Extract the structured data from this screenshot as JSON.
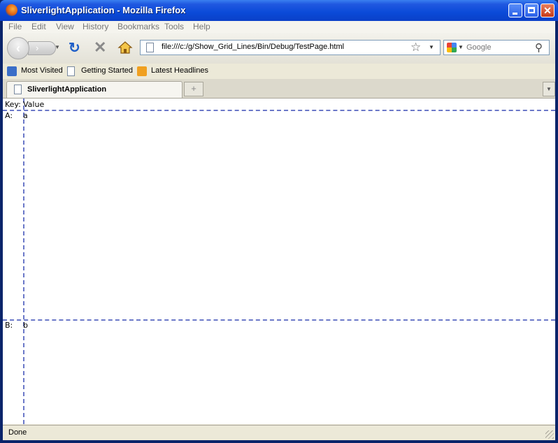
{
  "window": {
    "title": "SliverlightApplication - Mozilla Firefox",
    "close_glyph": "✕"
  },
  "menu": [
    "File",
    "Edit",
    "View",
    "History",
    "Bookmarks",
    "Tools",
    "Help"
  ],
  "nav": {
    "back_glyph": "‹",
    "forward_glyph": "›",
    "reload_glyph": "↻",
    "stop_glyph": "✕",
    "url": "file:///c:/g/Show_Grid_Lines/Bin/Debug/TestPage.html",
    "star_glyph": "☆",
    "search_placeholder": "Google",
    "search_glyph": "⚲"
  },
  "bookmarks": [
    "Most Visited",
    "Getting Started",
    "Latest Headlines"
  ],
  "tabs": [
    {
      "label": "SliverlightApplication"
    }
  ],
  "new_tab_glyph": "+",
  "page": {
    "header_key": "Key:",
    "header_value": "Value",
    "rows": [
      {
        "key": "A:",
        "value": "a"
      },
      {
        "key": "B:",
        "value": "b"
      }
    ]
  },
  "status": {
    "text": "Done"
  },
  "colors": {
    "titlebar": "#0a4ad8",
    "gridline": "#6b78c8",
    "chrome": "#ece9d8"
  },
  "icons": [
    "firefox-icon",
    "back-icon",
    "forward-icon",
    "reload-icon",
    "stop-icon",
    "home-icon",
    "page-icon",
    "star-icon",
    "google-icon",
    "magnifier-icon",
    "folder-icon",
    "rss-icon"
  ]
}
